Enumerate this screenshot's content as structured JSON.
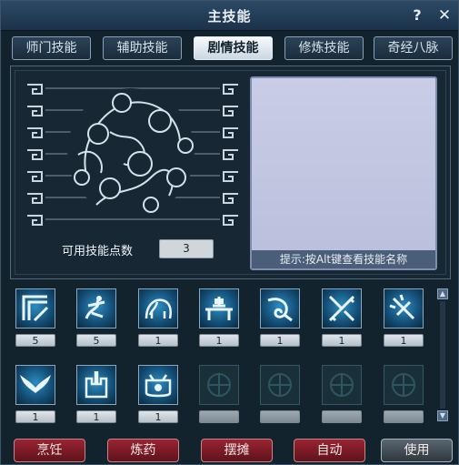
{
  "window": {
    "title": "主技能",
    "help_label": "?",
    "close_label": "✕"
  },
  "tabs": [
    {
      "label": "师门技能",
      "active": false
    },
    {
      "label": "辅助技能",
      "active": false
    },
    {
      "label": "剧情技能",
      "active": true
    },
    {
      "label": "修炼技能",
      "active": false
    },
    {
      "label": "奇经八脉",
      "active": false
    }
  ],
  "panel": {
    "points_label": "可用技能点数",
    "points_value": "3",
    "hint": "提示:按Alt键查看技能名称"
  },
  "skills": [
    {
      "icon": "corner-arrows-icon",
      "level": "5"
    },
    {
      "icon": "swirl-figure-icon",
      "level": "5"
    },
    {
      "icon": "elephant-icon",
      "level": "1"
    },
    {
      "icon": "cooking-table-icon",
      "level": "1"
    },
    {
      "icon": "horn-swirl-icon",
      "level": "1"
    },
    {
      "icon": "crossed-blades-icon",
      "level": "1"
    },
    {
      "icon": "sword-burst-icon",
      "level": "1"
    },
    {
      "icon": "wings-icon",
      "level": "1"
    },
    {
      "icon": "castle-icon",
      "level": "1"
    },
    {
      "icon": "cauldron-icon",
      "level": "1"
    },
    {
      "icon": "empty-slot-icon",
      "level": ""
    },
    {
      "icon": "empty-slot-icon",
      "level": ""
    },
    {
      "icon": "empty-slot-icon",
      "level": ""
    },
    {
      "icon": "empty-slot-icon",
      "level": ""
    }
  ],
  "buttons": {
    "cook": "烹饪",
    "alchemy": "炼药",
    "stall": "摆摊",
    "auto": "自动",
    "use": "使用"
  },
  "colors": {
    "accent_red": "#7a1a25",
    "panel_bg": "#172834",
    "desc_bg": "#c2c7e2"
  }
}
